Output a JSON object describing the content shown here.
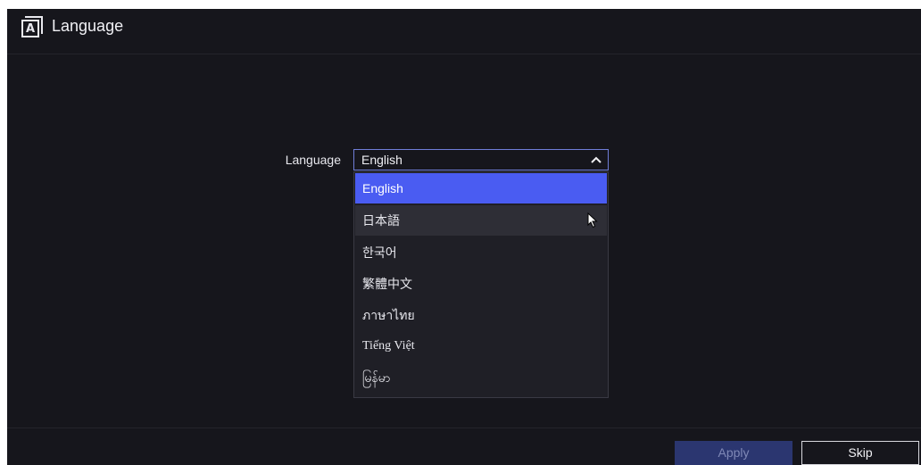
{
  "header": {
    "title": "Language",
    "icon": "language-icon"
  },
  "form": {
    "label": "Language",
    "selected_value": "English",
    "options": [
      "English",
      "日本語",
      "한국어",
      "繁體中文",
      "ภาษาไทย",
      "Tiếng Việt",
      "မြန်မာ"
    ],
    "selected_index": 0,
    "hovered_index": 1
  },
  "footer": {
    "apply_label": "Apply",
    "skip_label": "Skip"
  },
  "colors": {
    "background": "#16161c",
    "accent": "#4a5cf2",
    "apply_disabled": "#2b3670"
  }
}
